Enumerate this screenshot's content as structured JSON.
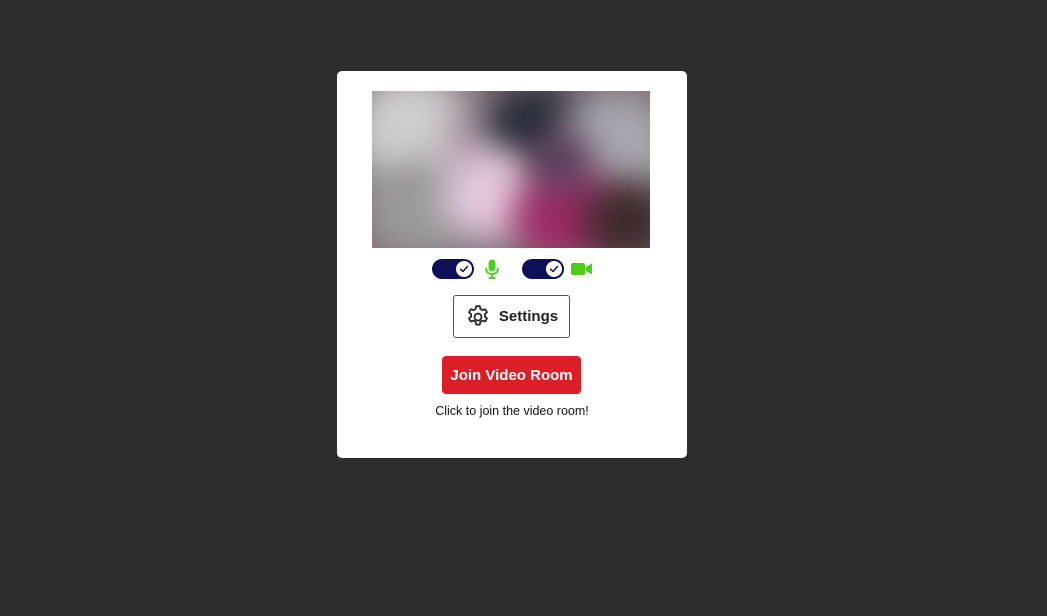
{
  "preview": {
    "icon": "camera-preview"
  },
  "controls": {
    "mic": {
      "enabled": true,
      "icon": "microphone-icon",
      "color": "#4ccd1a"
    },
    "camera": {
      "enabled": true,
      "icon": "video-camera-icon",
      "color": "#4ccd1a"
    },
    "toggle_color": "#0d1056"
  },
  "settings_button": {
    "label": "Settings",
    "icon": "gear-icon"
  },
  "join_button": {
    "label": "Join Video Room",
    "color": "#dc1f26"
  },
  "hint_text": "Click to join the video room!"
}
